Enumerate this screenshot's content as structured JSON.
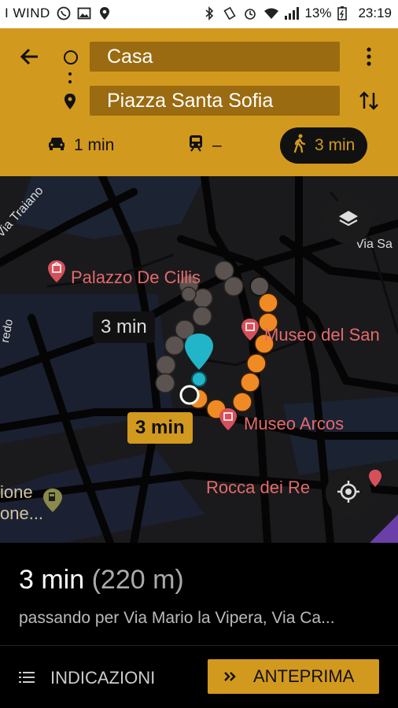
{
  "status_bar": {
    "carrier": "I WIND",
    "battery": "13%",
    "time": "23:19"
  },
  "header": {
    "origin": "Casa",
    "destination": "Piazza Santa Sofia",
    "modes": [
      {
        "name": "drive",
        "label": "1 min"
      },
      {
        "name": "transit",
        "label": "–"
      },
      {
        "name": "walk",
        "label": "3 min"
      }
    ]
  },
  "map": {
    "street_labels": [
      "Via Traiano",
      "Via Sa",
      "redo"
    ],
    "poi_labels": [
      "Palazzo De Cillis",
      "Museo del San",
      "Museo Arcos",
      "Rocca dei Re"
    ],
    "partial_poi": [
      "ione",
      "one..."
    ],
    "route_bubbles": [
      "3 min",
      "3 min"
    ]
  },
  "summary": {
    "time": "3 min",
    "distance": "(220 m)",
    "via": "passando per Via Mario la Vipera, Via Ca..."
  },
  "actions": {
    "directions": "INDICAZIONI",
    "preview": "ANTEPRIMA"
  },
  "colors": {
    "accent": "#d2991f",
    "route_orange": "#f08a24",
    "route_grey": "#5b5350"
  }
}
